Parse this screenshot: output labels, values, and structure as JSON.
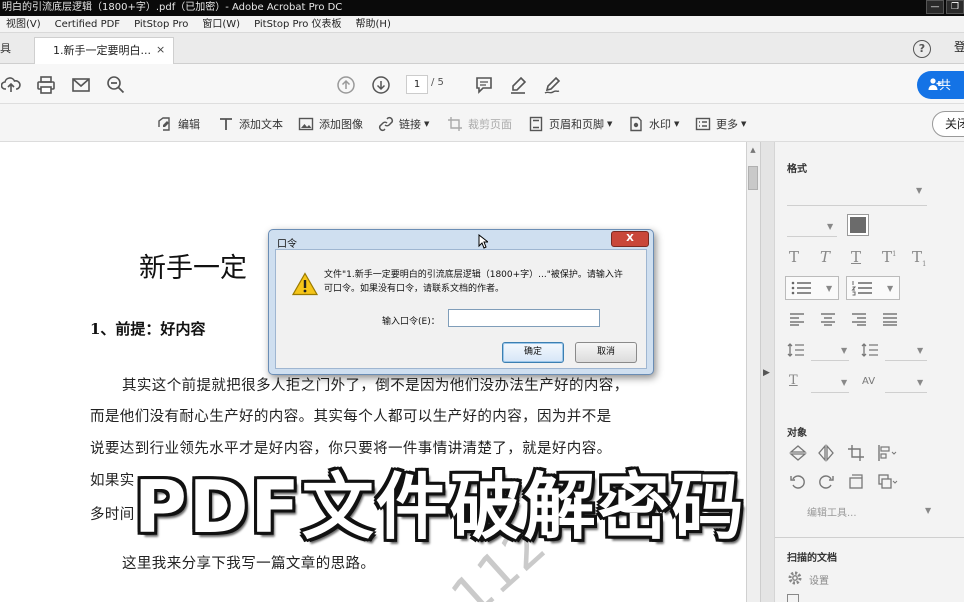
{
  "window": {
    "title": "明白的引流底层逻辑（1800+字）.pdf（已加密）- Adobe Acrobat Pro DC",
    "controls": [
      "—",
      "❐"
    ]
  },
  "menubar": {
    "items": [
      "视图(V)",
      "Certified PDF",
      "PitStop Pro",
      "窗口(W)",
      "PitStop Pro 仪表板",
      "帮助(H)"
    ]
  },
  "tabs": {
    "tools_label": "具",
    "doc_tab_label": "1.新手一定要明白...",
    "close_glyph": "×",
    "signin_label": "登"
  },
  "toolbar": {
    "page_current": "1",
    "page_total": "/ 5",
    "share_label": "共"
  },
  "edit_toolbar": {
    "edit_label": "编辑",
    "add_text_label": "添加文本",
    "add_image_label": "添加图像",
    "link_label": "链接",
    "crop_label": "裁剪页面",
    "header_footer_label": "页眉和页脚",
    "watermark_label": "水印",
    "more_label": "更多",
    "close_label": "关闭"
  },
  "document": {
    "title": "新手一定",
    "heading1": "1、前提：好内容",
    "paragraphs": [
      "其实这个前提就把很多人拒之门外了，倒不是因为他们没办法生产好的内容，",
      "而是他们没有耐心生产好的内容。其实每个人都可以生产好的内容，因为并不是",
      "说要达到行业领先水平才是好内容，你只要将一件事情讲清楚了，就是好内容。",
      "如果实",
      "多时间"
    ],
    "paragraph_last": "这里我来分享下我写一篇文章的思路。",
    "watermark": "112"
  },
  "right_panel": {
    "format_label": "格式",
    "object_label": "对象",
    "edit_tools_label": "编辑工具...",
    "scanned_label": "扫描的文档",
    "settings_label": "设置"
  },
  "dialog": {
    "title": "口令",
    "close_glyph": "X",
    "message_line1": "文件\"1.新手一定要明白的引流底层逻辑（1800+字）...\"被保护。请输入许",
    "message_line2": "可口令。如果没有口令，请联系文档的作者。",
    "input_label": "输入口令(E)：",
    "input_value": "",
    "ok_label": "确定",
    "cancel_label": "取消"
  },
  "overlay": {
    "caption": "PDF文件破解密码"
  }
}
